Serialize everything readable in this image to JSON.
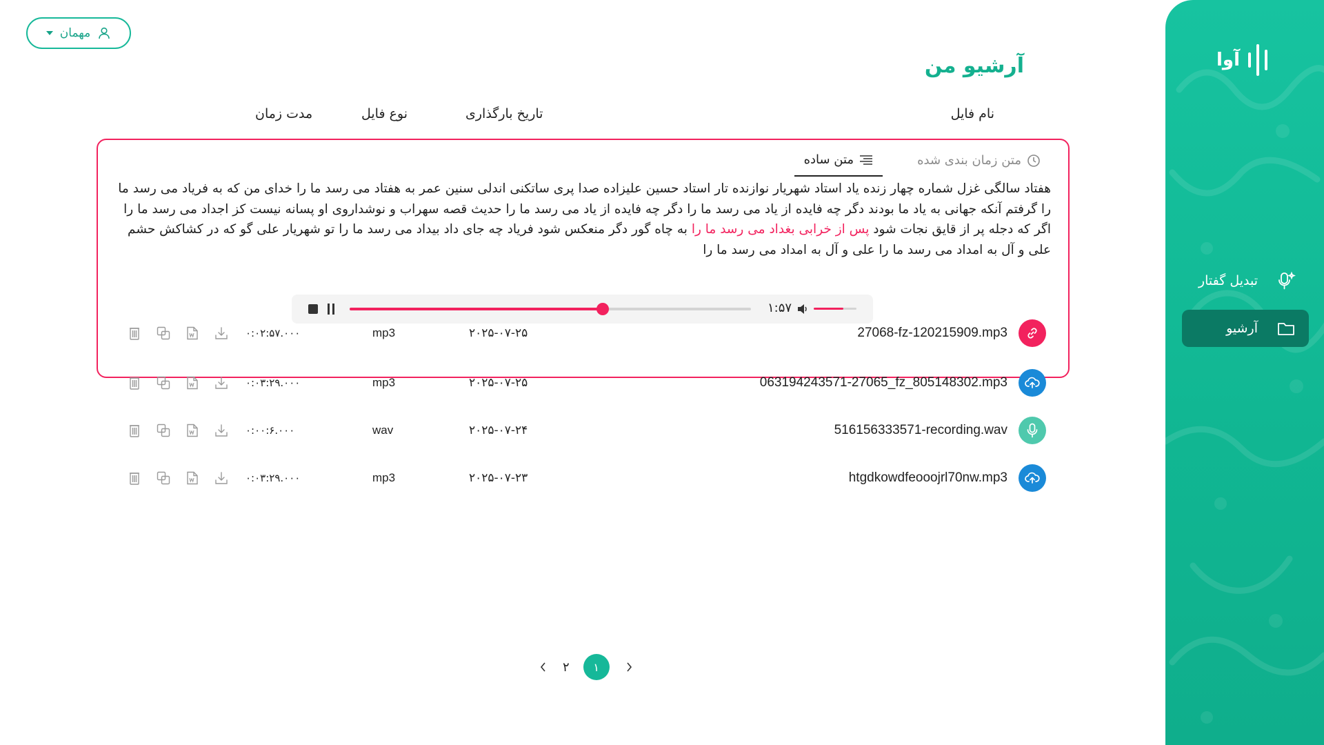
{
  "brand": {
    "name": "آوا"
  },
  "sidebar": {
    "items": [
      {
        "label": "تبدیل گفتار",
        "icon": "microphone-sparkle-icon"
      },
      {
        "label": "آرشیو",
        "icon": "folder-icon"
      }
    ]
  },
  "user": {
    "label": "مهمان"
  },
  "page_title": "آرشیو من",
  "table": {
    "headers": {
      "name": "نام فایل",
      "date": "تاریخ بارگذاری",
      "type": "نوع فایل",
      "duration": "مدت زمان"
    }
  },
  "expanded": {
    "tabs": [
      {
        "label": "متن ساده"
      },
      {
        "label": "متن زمان بندی شده"
      }
    ],
    "transcript": {
      "before": "هفتاد سالگی غزل شماره چهار زنده یاد استاد شهریار نوازنده تار استاد حسین علیزاده صدا پری ساتکنی اندلی سنین عمر به هفتاد می رسد ما را خدای من که به فریاد می رسد ما را گرفتم آنکه جهانی به یاد ما بودند دگر چه فایده از یاد می رسد ما را دگر چه فایده از یاد می رسد ما را حدیث قصه سهراب و نوشداروی او پسانه نیست کز اجداد می رسد ما را اگر که دجله پر از قایق نجات شود ",
      "highlight": "پس از خرابی بغداد می رسد ما را",
      "after": " به چاه گور دگر منعکس شود فریاد چه جای داد بیداد می رسد ما را تو شهریار علی گو که در کشاکش حشم علی و آل به امداد می رسد ما را علی و آل به امداد می رسد ما را"
    },
    "player": {
      "time": "۱:۵۷",
      "progress": 0.63,
      "volume": 0.7
    }
  },
  "files": [
    {
      "name": "27068-fz-120215909.mp3",
      "date": "۲۰۲۵-۰۷-۲۵",
      "type": "mp3",
      "duration": "۰:۰۲:۵۷.۰۰۰",
      "source": "link",
      "icon": "link-icon",
      "color": "#f2225e"
    },
    {
      "name": "063194243571-27065_fz_805148302.mp3",
      "date": "۲۰۲۵-۰۷-۲۵",
      "type": "mp3",
      "duration": "۰:۰۳:۲۹.۰۰۰",
      "source": "upload",
      "icon": "cloud-upload-icon",
      "color": "#1a8ad8"
    },
    {
      "name": "516156333571-recording.wav",
      "date": "۲۰۲۵-۰۷-۲۴",
      "type": "wav",
      "duration": "۰:۰۰:۶.۰۰۰",
      "source": "record",
      "icon": "microphone-icon",
      "color": "#4fc9ad"
    },
    {
      "name": "htgdkowdfeooojrl70nw.mp3",
      "date": "۲۰۲۵-۰۷-۲۳",
      "type": "mp3",
      "duration": "۰:۰۳:۲۹.۰۰۰",
      "source": "upload",
      "icon": "cloud-upload-icon",
      "color": "#1a8ad8"
    }
  ],
  "pagination": {
    "pages": [
      "۱",
      "۲"
    ],
    "current": "۱"
  },
  "colors": {
    "brand": "#16b899",
    "accent": "#f2225e",
    "upload": "#1a8ad8"
  }
}
